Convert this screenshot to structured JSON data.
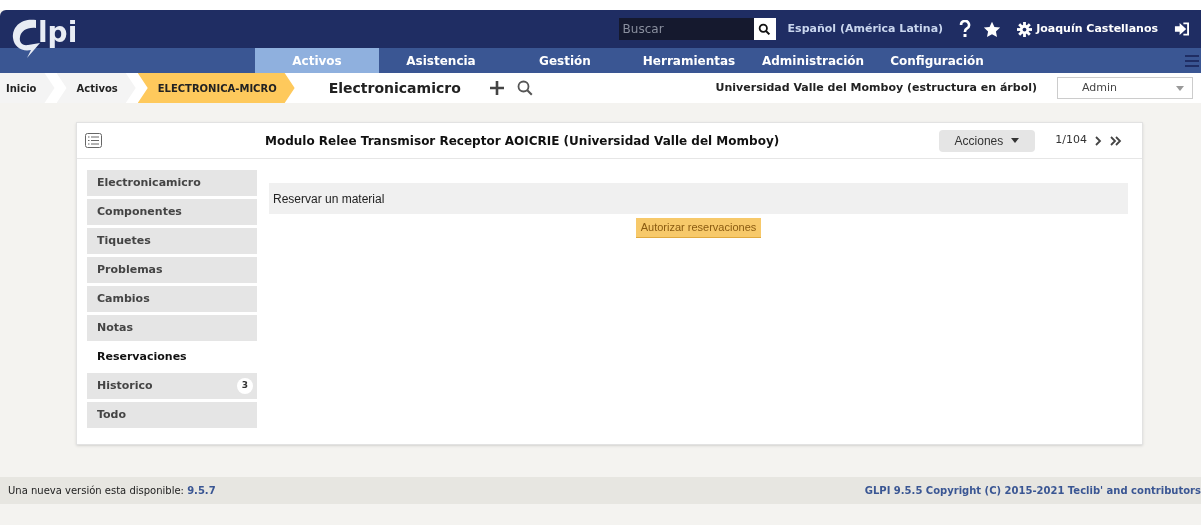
{
  "header": {
    "logo": "lpi",
    "search": {
      "placeholder": "Buscar"
    },
    "language": "Español (América Latina)",
    "user": "Joaquín Castellanos"
  },
  "menu": [
    {
      "label": "Activos",
      "selected": true
    },
    {
      "label": "Asistencia",
      "selected": false
    },
    {
      "label": "Gestión",
      "selected": false
    },
    {
      "label": "Herramientas",
      "selected": false
    },
    {
      "label": "Administración",
      "selected": false
    },
    {
      "label": "Configuración",
      "selected": false
    }
  ],
  "breadcrumb": [
    {
      "label": "Inicio",
      "selected": false
    },
    {
      "label": "Activos",
      "selected": false
    },
    {
      "label": "ELECTRONICA-MICRO",
      "selected": true
    }
  ],
  "page_title": "Electronicamicro",
  "entity": "Universidad Valle del Momboy (estructura en árbol)",
  "profile": "Admin",
  "card": {
    "title": "Modulo Relee Transmisor Receptor AOICRIE (Universidad Valle del Momboy)",
    "actions": "Acciones",
    "pager": "1/104",
    "tabs": [
      {
        "label": "Electronicamicro",
        "selected": false
      },
      {
        "label": "Componentes",
        "selected": false
      },
      {
        "label": "Tiquetes",
        "selected": false
      },
      {
        "label": "Problemas",
        "selected": false
      },
      {
        "label": "Cambios",
        "selected": false
      },
      {
        "label": "Notas",
        "selected": false
      },
      {
        "label": "Reservaciones",
        "selected": true
      },
      {
        "label": "Historico",
        "selected": false,
        "count": "3"
      },
      {
        "label": "Todo",
        "selected": false
      }
    ],
    "section_header": "Reservar un material",
    "button": "Autorizar reservaciones"
  },
  "footer": {
    "notice": "Una nueva versión esta disponible: ",
    "version": "9.5.7",
    "copyright": "GLPI 9.5.5 Copyright (C) 2015-2021 Teclib' and contributors"
  }
}
